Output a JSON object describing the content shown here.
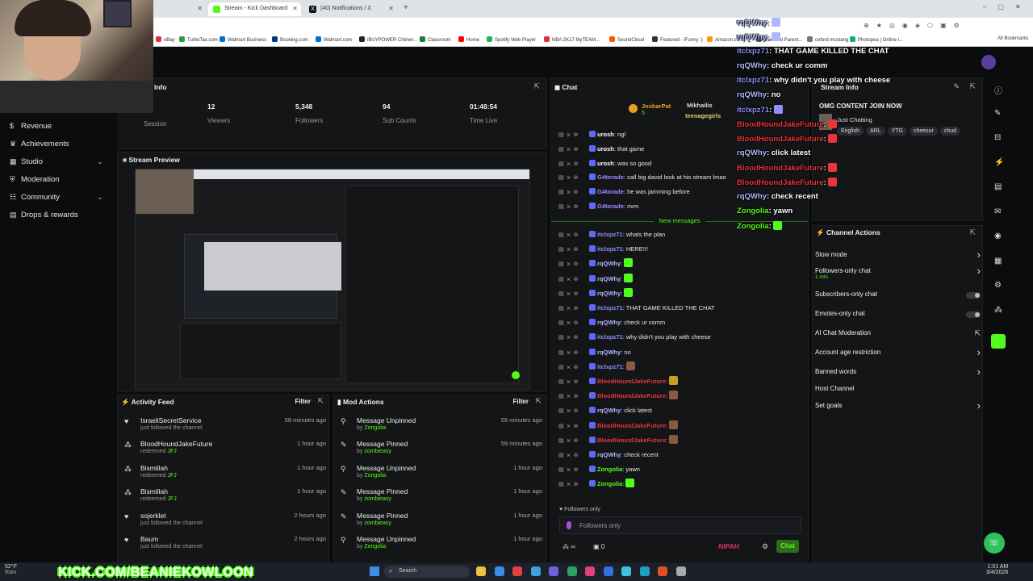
{
  "browser": {
    "tabs": [
      {
        "label": "Stream - Kick Dashboard",
        "color": "#53fc18"
      },
      {
        "label": "(40) Notifications / X",
        "color": "#000000"
      }
    ],
    "bookmarks": [
      "eBay",
      "TurboTax.com",
      "Walmart Business",
      "Booking.com",
      "Walmart.com",
      "iBUYPOWER Chimer...",
      "Classroom",
      "Home",
      "Spotify Web Player",
      "NBA 2K17 MyTEAM...",
      "SoundCloud",
      "Featured - iFunny :)",
      "Amazon.com",
      "Ganvard Parent...",
      "oxford mustang",
      "Photopea | Online i..."
    ],
    "all_bookmarks": "All Bookmarks"
  },
  "sidebar": {
    "items": [
      {
        "label": "Revenue",
        "icon": "dollar-icon"
      },
      {
        "label": "Achievements",
        "icon": "trophy-icon"
      },
      {
        "label": "Studio",
        "icon": "studio-icon",
        "expandable": true
      },
      {
        "label": "Moderation",
        "icon": "shield-icon"
      },
      {
        "label": "Community",
        "icon": "people-icon",
        "expandable": true
      },
      {
        "label": "Drops & rewards",
        "icon": "gift-icon"
      }
    ]
  },
  "session": {
    "title": "Info",
    "session_label": "Session",
    "stats": [
      {
        "value": "12",
        "label": "Viewers"
      },
      {
        "value": "5,348",
        "label": "Followers"
      },
      {
        "value": "94",
        "label": "Sub Counts"
      },
      {
        "value": "01:48:54",
        "label": "Time Live"
      }
    ]
  },
  "preview": {
    "title": "Stream Preview"
  },
  "activity": {
    "title": "Activity Feed",
    "filter": "Filter",
    "items": [
      {
        "name": "IsraeliSecretService",
        "sub": "just followed the channel",
        "time": "58 minutes ago",
        "icon": "heart-icon"
      },
      {
        "name": "BloodHoundJakeFuture",
        "sub": "redeemed",
        "reward": "JFJ",
        "time": "1 hour ago",
        "icon": "redeem-icon"
      },
      {
        "name": "Bismillah",
        "sub": "redeemed",
        "reward": "JFJ",
        "time": "1 hour ago",
        "icon": "redeem-icon"
      },
      {
        "name": "Bismillah",
        "sub": "redeemed",
        "reward": "JFJ",
        "time": "1 hour ago",
        "icon": "redeem-icon"
      },
      {
        "name": "sojerklet",
        "sub": "just followed the channel",
        "time": "2 hours ago",
        "icon": "heart-icon"
      },
      {
        "name": "Baum",
        "sub": "just followed the channel",
        "time": "2 hours ago",
        "icon": "heart-icon"
      }
    ]
  },
  "modactions": {
    "title": "Mod Actions",
    "filter": "Filter",
    "items": [
      {
        "action": "Message Unpinned",
        "by": "by",
        "who": "Zongolia",
        "time": "59 minutes ago",
        "icon": "unpin-icon"
      },
      {
        "action": "Message Pinned",
        "by": "by",
        "who": "zombieasy",
        "time": "59 minutes ago",
        "icon": "pin-icon"
      },
      {
        "action": "Message Unpinned",
        "by": "by",
        "who": "Zongolia",
        "time": "1 hour ago",
        "icon": "unpin-icon"
      },
      {
        "action": "Message Pinned",
        "by": "by",
        "who": "zombieasy",
        "time": "1 hour ago",
        "icon": "pin-icon"
      },
      {
        "action": "Message Pinned",
        "by": "by",
        "who": "zombieasy",
        "time": "1 hour ago",
        "icon": "pin-icon"
      },
      {
        "action": "Message Unpinned",
        "by": "by",
        "who": "Zongolia",
        "time": "1 hour ago",
        "icon": "unpin-icon"
      }
    ]
  },
  "chat": {
    "title": "Chat",
    "top_users": [
      "JosbarPat",
      "Mikhailis",
      "teenagegirls"
    ],
    "top_count": "5",
    "new_messages": "New messages",
    "lines": [
      {
        "user": "urosh",
        "color": "#ffffff",
        "text": "ngl"
      },
      {
        "user": "urosh",
        "color": "#ffffff",
        "text": "that game"
      },
      {
        "user": "urosh",
        "color": "#ffffff",
        "text": "was so good"
      },
      {
        "user": "G4torade",
        "color": "#9b8cff",
        "text": "call big david look at his stream lmao"
      },
      {
        "user": "G4torade",
        "color": "#9b8cff",
        "text": "he was jamming before"
      },
      {
        "user": "G4torade",
        "color": "#9b8cff",
        "text": "nvm"
      },
      {
        "user": "itclxpz71",
        "color": "#8f8fff",
        "text": "whats the plan"
      },
      {
        "user": "itclxpz71",
        "color": "#8f8fff",
        "text": "HERE!!!"
      },
      {
        "user": "rqQWhy",
        "color": "#b0b6ff",
        "text": "",
        "emote": "#53fc18"
      },
      {
        "user": "rqQWhy",
        "color": "#b0b6ff",
        "text": "",
        "emote": "#53fc18"
      },
      {
        "user": "rqQWhy",
        "color": "#b0b6ff",
        "text": "",
        "emote": "#53fc18"
      },
      {
        "user": "itclxpz71",
        "color": "#8f8fff",
        "text": "THAT GAME KILLED THE CHAT"
      },
      {
        "user": "rqQWhy",
        "color": "#b0b6ff",
        "text": "check ur comm"
      },
      {
        "user": "itclxpz71",
        "color": "#8f8fff",
        "text": "why didn't you play with cheese"
      },
      {
        "user": "rqQWhy",
        "color": "#b0b6ff",
        "text": "no"
      },
      {
        "user": "itclxpz71",
        "color": "#8f8fff",
        "text": "",
        "emote": "#8a5a40"
      },
      {
        "user": "BloodHoundJakeFuture",
        "color": "#e8363a",
        "text": "",
        "emote": "#c8a020"
      },
      {
        "user": "BloodHoundJakeFuture",
        "color": "#e8363a",
        "text": "",
        "emote": "#8a5a40"
      },
      {
        "user": "rqQWhy",
        "color": "#b0b6ff",
        "text": "click latest"
      },
      {
        "user": "BloodHoundJakeFuture",
        "color": "#e8363a",
        "text": "",
        "emote": "#8a5a40"
      },
      {
        "user": "BloodHoundJakeFuture",
        "color": "#e8363a",
        "text": "",
        "emote": "#8a5a40"
      },
      {
        "user": "rqQWhy",
        "color": "#b0b6ff",
        "text": "check recent"
      },
      {
        "user": "Zongolia",
        "color": "#53fc18",
        "text": "yawn"
      },
      {
        "user": "Zongolia",
        "color": "#53fc18",
        "text": "",
        "emote": "#53fc18"
      }
    ],
    "followers_only": "Followers only",
    "input_placeholder": "Followers only",
    "count_a": "0",
    "count_b": "0",
    "send": "Chat",
    "logo": "NIPAH"
  },
  "stream_info": {
    "title": "Stream Info",
    "stream_title": "OMG CONTENT JOIN NOW",
    "category": "Just Chatting",
    "tags": [
      "English",
      "ARL",
      "YTG",
      "cheesur",
      "chud"
    ]
  },
  "channel_actions": {
    "title": "Channel Actions",
    "items": [
      {
        "label": "Slow mode",
        "type": "chevron"
      },
      {
        "label": "Followers-only chat",
        "sub": "1 min",
        "type": "chevron"
      },
      {
        "label": "Subscribers-only chat",
        "type": "toggle"
      },
      {
        "label": "Emotes-only chat",
        "type": "toggle"
      },
      {
        "label": "AI Chat Moderation",
        "type": "link"
      },
      {
        "label": "Account age restriction",
        "type": "chevron"
      },
      {
        "label": "Banned words",
        "type": "chevron"
      },
      {
        "label": "Host Channel",
        "type": "none"
      },
      {
        "label": "Set goals",
        "type": "chevron"
      }
    ]
  },
  "overlay_chat": [
    {
      "user": "rqQWhy",
      "color": "#b0b6ff",
      "text": ": ",
      "emote": true
    },
    {
      "user": "rqQWhy",
      "color": "#b0b6ff",
      "text": ": ",
      "emote": true
    },
    {
      "user": "itclxpz71",
      "color": "#8f8fff",
      "text": ": THAT GAME KILLED THE CHAT"
    },
    {
      "user": "rqQWhy",
      "color": "#b0b6ff",
      "text": ": check ur comm"
    },
    {
      "user": "itclxpz71",
      "color": "#8f8fff",
      "text": ": why didn't you play with cheese"
    },
    {
      "user": "rqQWhy",
      "color": "#b0b6ff",
      "text": ": no"
    },
    {
      "user": "itclxpz71",
      "color": "#8f8fff",
      "text": ": ",
      "emote": true
    },
    {
      "user": "BloodHoundJakeFuture",
      "color": "#e8363a",
      "text": ": ",
      "emote": true
    },
    {
      "user": "BloodHoundJakeFuture",
      "color": "#e8363a",
      "text": ": ",
      "emote": true
    },
    {
      "user": "rqQWhy",
      "color": "#b0b6ff",
      "text": ": click latest"
    },
    {
      "user": "BloodHoundJakeFuture",
      "color": "#e8363a",
      "text": ": ",
      "emote": true
    },
    {
      "user": "BloodHoundJakeFuture",
      "color": "#e8363a",
      "text": ": ",
      "emote": true
    },
    {
      "user": "rqQWhy",
      "color": "#b0b6ff",
      "text": ": check recent"
    },
    {
      "user": "Zongolia",
      "color": "#53fc18",
      "text": ": yawn"
    },
    {
      "user": "Zongolia",
      "color": "#53fc18",
      "text": ": ",
      "emote": true
    }
  ],
  "watermark": "KICK.COM/BEANIEKOWLOON",
  "taskbar": {
    "weather_temp": "52°F",
    "weather_label": "Rain",
    "search": "Search",
    "time": "1:01 AM",
    "date": "3/4/2026"
  },
  "colors": {
    "accent": "#53fc18",
    "bg": "#0b0c0e",
    "panel": "#141517"
  }
}
